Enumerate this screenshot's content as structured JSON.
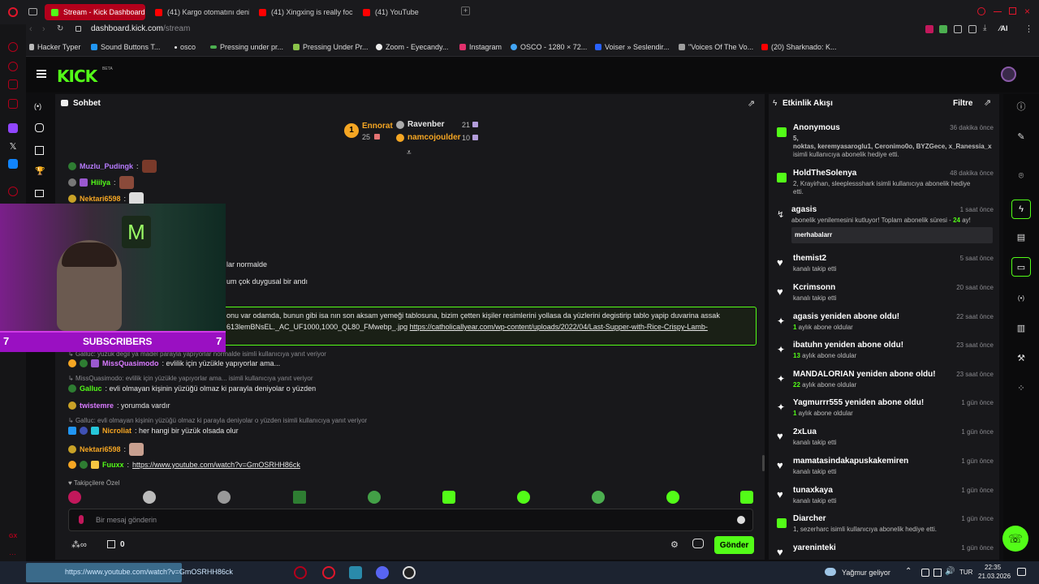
{
  "browser": {
    "tabs": [
      {
        "label": "Stream - Kick Dashboard",
        "active": true,
        "icon": "kick-icon"
      },
      {
        "label": "(41) Kargo otomatını deniy",
        "active": false,
        "icon": "youtube-icon"
      },
      {
        "label": "(41) Xingxing is really focu",
        "active": false,
        "icon": "youtube-icon"
      },
      {
        "label": "(41) YouTube",
        "active": false,
        "icon": "youtube-icon"
      }
    ],
    "url_host": "dashboard.kick.com",
    "url_path": "/stream",
    "ai_label": "AI",
    "bookmarks": [
      "Hacker Typer",
      "Sound Buttons T...",
      "osco",
      "Pressing under pr...",
      "Pressing Under Pr...",
      "Zoom - Eyecandy...",
      "Instagram",
      "OSCO - 1280 × 72...",
      "Voiser » Seslendir...",
      "\"Voices Of The Vo...",
      "(20) Sharknado: K..."
    ],
    "gx_label": "GX"
  },
  "kick": {
    "logo": "KICK",
    "beta": "BETA",
    "accent": "#53fc18"
  },
  "chat": {
    "title": "Sohbet",
    "top": [
      {
        "rank": "1",
        "name": "Ennorat",
        "count": "25"
      },
      {
        "name": "Ravenber",
        "count": "21"
      },
      {
        "name": "namcojoulder",
        "count": "10"
      }
    ],
    "messages": [
      {
        "user": "Muzlu_Pudingk",
        "text": ":",
        "color": "#b87cff"
      },
      {
        "user": "Hiilya",
        "text": ":",
        "color": "#53fc18"
      },
      {
        "user": "Nektari6598",
        "text": ":",
        "color": "#f5a623"
      }
    ],
    "partial1": "lar normalde",
    "partial2": "um çok duygusal bir andı",
    "highlight_line1": "onu var odamda, bunun gibi isa nın son aksam yemeği tablosuna, bizim çetten kişiler resimlerini yollasa da yüzlerini degistirip tablo yapip duvarina assak",
    "highlight_line2a": "613lemBNsEL._AC_UF1000,1000_QL80_FMwebp_.jpg",
    "highlight_line2b": "https://catholicallyear.com/wp-content/uploads/2022/04/Last-Supper-with-Rice-Crispy-Lamb-",
    "reply1": "Galluc: yüzük değil ya madel parayla yapıyorlar normalde isimli kullanıcıya yanıt veriyor",
    "msg1_user": "MissQuasimodo",
    "msg1_text": ": evlilik için yüzükle yapıyorlar ama...",
    "reply2": "MissQuasimodo: evlilik için yüzükle yapıyorlar ama... isimli kullanıcıya yanıt veriyor",
    "msg2_user": "Galluc",
    "msg2_text": ": evli olmayan kişinin yüzüğü olmaz ki parayla deniyolar o yüzden",
    "msg3_user": "twistemre",
    "msg3_text": ": yorumda vardır",
    "reply3": "Galluc: evli olmayan kişinin yüzüğü olmaz ki parayla deniyolar o yüzden isimli kullanıcıya yanıt veriyor",
    "msg4_user": "Nicroliat",
    "msg4_text": ": her hangi bir yüzük olsada olur",
    "msg5_user": "Nektari6598",
    "msg5_text": ":",
    "msg6_user": "Fuuxx",
    "msg6_text": ":",
    "msg6_link": "https://www.youtube.com/watch?v=GmOSRHH86ck",
    "emote_label": "Takipçilere Özel",
    "input_placeholder": "Bir mesaj gönderin",
    "bottom_count": "0",
    "send": "Gönder"
  },
  "webcam": {
    "left_count": "7",
    "label": "SUBSCRIBERS",
    "right_count": "7"
  },
  "activity": {
    "title": "Etkinlik Akışı",
    "filter": "Filtre",
    "items": [
      {
        "icon": "gift-icon",
        "name": "Anonymous",
        "time": "36 dakika önce",
        "line1": "5,",
        "line2": "noktas, keremyasaroglu1, Ceronimo0o, BYZGece, x_Ranessia_x",
        "line3": "isimli kullanıcıya abonelik hediye etti."
      },
      {
        "icon": "gift-icon",
        "name": "HoldTheSolenya",
        "time": "48 dakika önce",
        "line1": "2, Krayirhan, sleeplessshark isimli kullanıcıya abonelik hediye",
        "line2": "etti."
      },
      {
        "icon": "renew-icon",
        "name": "agasis",
        "time": "1 saat önce",
        "line1": "abonelik yenilemesini kutluyor! Toplam abonelik süresi - ",
        "months": "24",
        "after": " ay!",
        "note": "merhabalarr"
      },
      {
        "icon": "heart-icon",
        "name": "themist2",
        "time": "5 saat önce",
        "line1": "kanalı takip etti"
      },
      {
        "icon": "heart-icon",
        "name": "Kcrimsonn",
        "time": "20 saat önce",
        "line1": "kanalı takip etti"
      },
      {
        "icon": "star-icon",
        "name": "agasis yeniden abone oldu!",
        "time": "22 saat önce",
        "months": "1",
        "line1": " aylık abone oldular"
      },
      {
        "icon": "star-icon",
        "name": "ibatuhn yeniden abone oldu!",
        "time": "23 saat önce",
        "months": "13",
        "line1": " aylık abone oldular"
      },
      {
        "icon": "star-icon",
        "name": "MANDALORIAN yeniden abone oldu!",
        "time": "23 saat önce",
        "months": "22",
        "line1": " aylık abone oldular"
      },
      {
        "icon": "star-icon",
        "name": "Yagmurrr555 yeniden abone oldu!",
        "time": "1 gün önce",
        "months": "1",
        "line1": " aylık abone oldular"
      },
      {
        "icon": "heart-icon",
        "name": "2xLua",
        "time": "1 gün önce",
        "line1": "kanalı takip etti"
      },
      {
        "icon": "heart-icon",
        "name": "mamatasindakapuskakemiren",
        "time": "1 gün önce",
        "line1": "kanalı takip etti"
      },
      {
        "icon": "heart-icon",
        "name": "tunaxkaya",
        "time": "1 gün önce",
        "line1": "kanalı takip etti"
      },
      {
        "icon": "gift-icon",
        "name": "Diarcher",
        "time": "1 gün önce",
        "line1": "1, sezerharc isimli kullanıcıya abonelik hediye etti."
      },
      {
        "icon": "heart-icon",
        "name": "yareninteki",
        "time": "1 gün önce",
        "line1": ""
      }
    ]
  },
  "taskbar": {
    "ticker": "https://www.youtube.com/watch?v=GmOSRHH86ck",
    "weather": "Yağmur geliyor",
    "lang": "TUR",
    "time": "22:35",
    "date": "21.03.2026"
  }
}
